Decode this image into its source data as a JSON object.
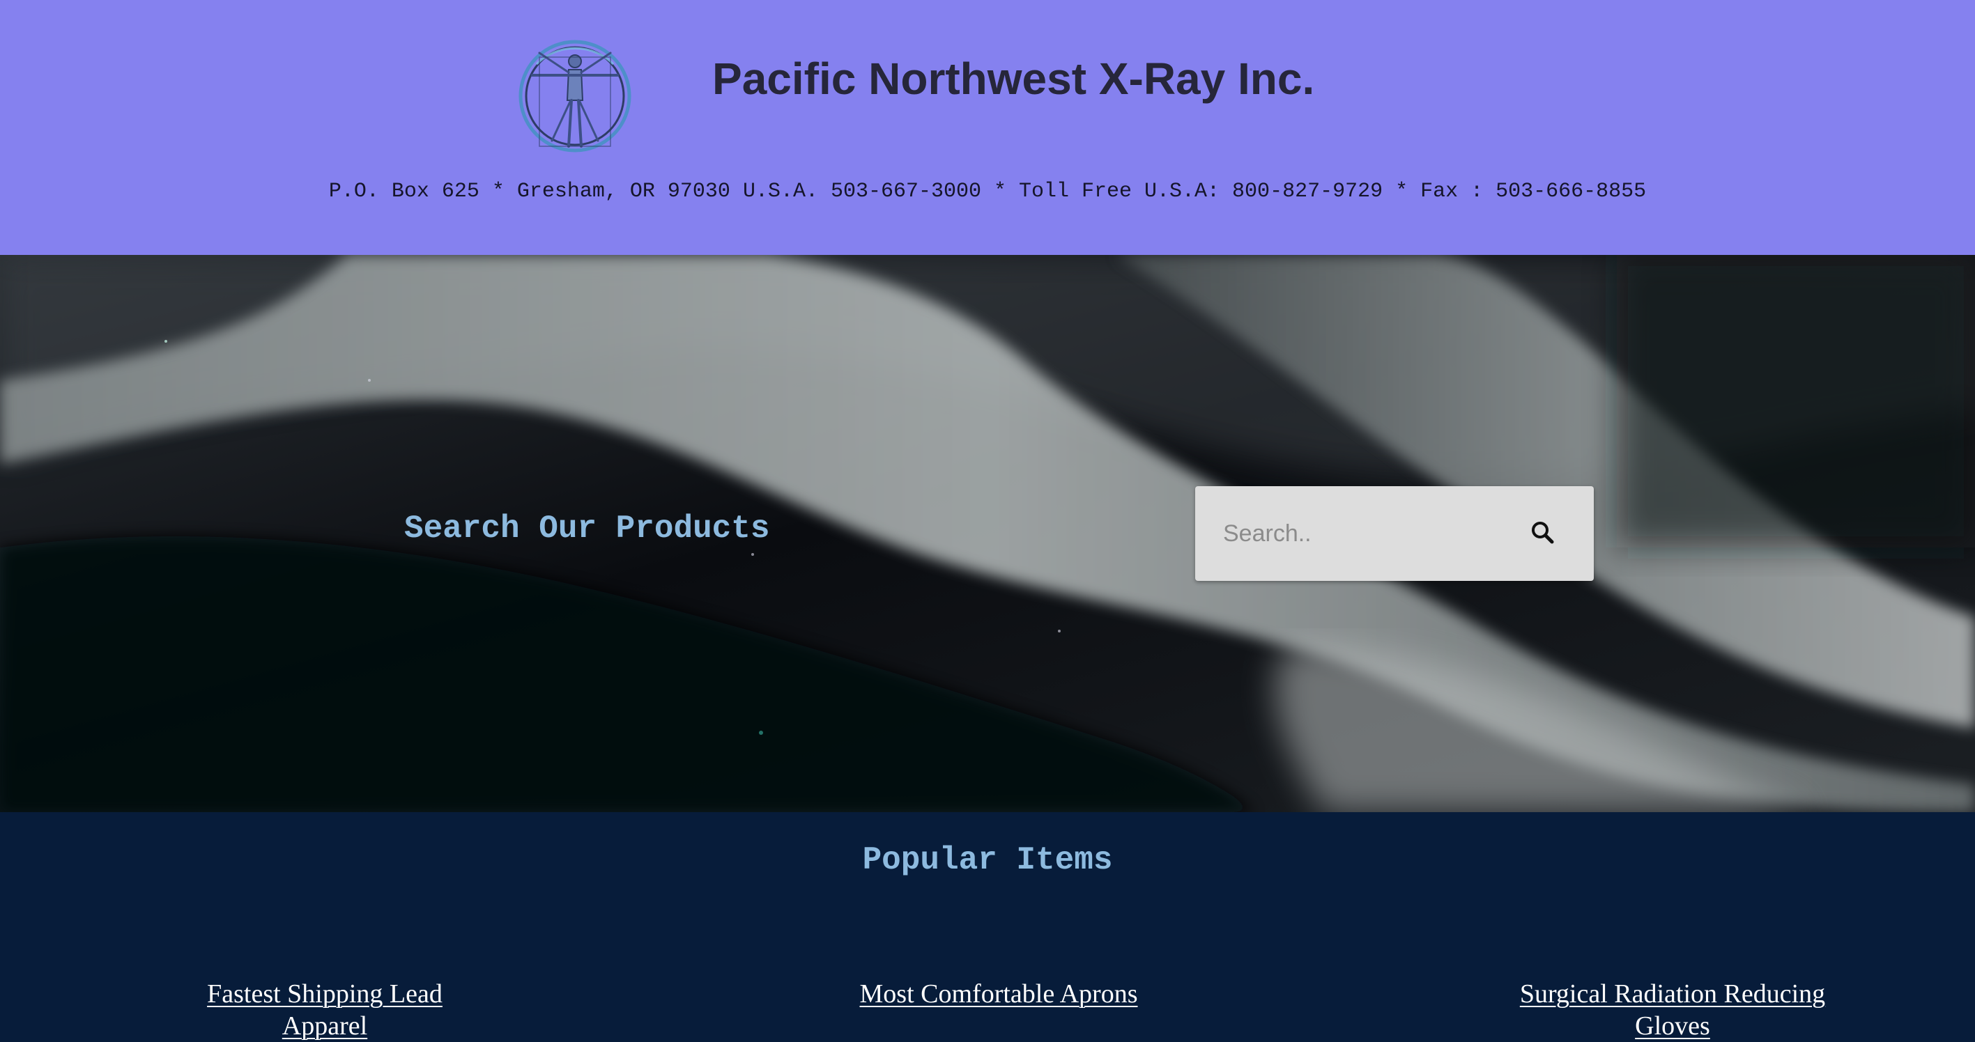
{
  "header": {
    "company_name": "Pacific Northwest X-Ray Inc.",
    "contact_line": "P.O. Box 625 * Gresham, OR 97030 U.S.A. 503-667-3000 * Toll Free U.S.A: 800-827-9729 * Fax : 503-666-8855",
    "background_color": "#8581ef",
    "logo_icon": "vitruvian-man-logo"
  },
  "hero": {
    "heading": "Search Our Products",
    "heading_color": "#8dbadf",
    "search": {
      "placeholder": "Search..",
      "value": "",
      "button_icon": "search-icon"
    }
  },
  "popular": {
    "title": "Popular Items",
    "background_color": "#071c3a",
    "items": [
      {
        "label": "Fastest Shipping Lead Apparel"
      },
      {
        "label": "Most Comfortable Aprons"
      },
      {
        "label": "Surgical Radiation Reducing Gloves"
      }
    ]
  }
}
